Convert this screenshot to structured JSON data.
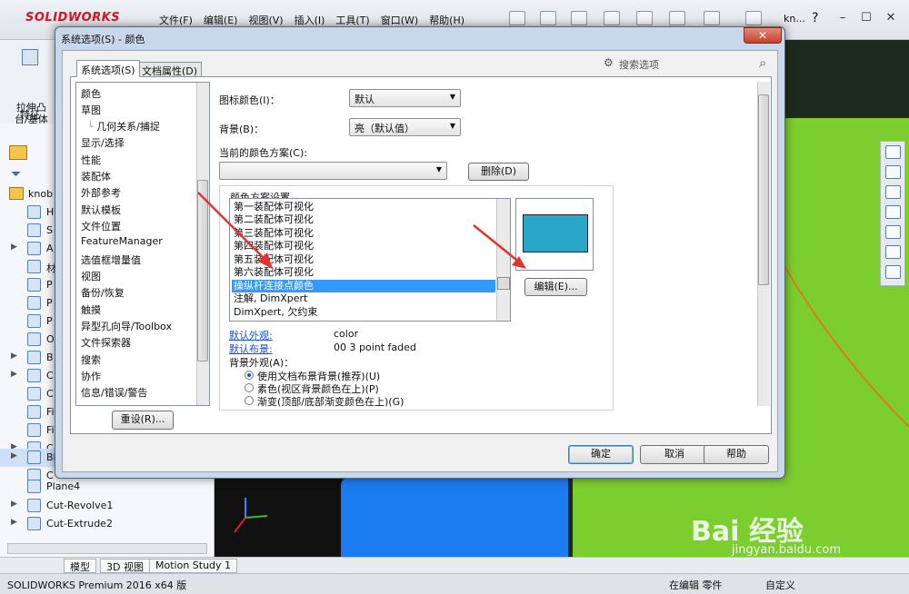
{
  "app": {
    "logo": "SOLIDWORKS",
    "menus": [
      "文件(F)",
      "编辑(E)",
      "视图(V)",
      "插入(I)",
      "工具(T)",
      "窗口(W)",
      "帮助(H)"
    ],
    "user": "kn...",
    "help": "?"
  },
  "command_manager": {
    "extrude_label": "拉伸凸\n台/基体",
    "feature_tab": "特征"
  },
  "tree": {
    "root": "knob",
    "rows": [
      {
        "label": "H"
      },
      {
        "label": "S"
      },
      {
        "label": "A"
      },
      {
        "label": "材"
      },
      {
        "label": "P"
      },
      {
        "label": "P"
      },
      {
        "label": "P"
      },
      {
        "label": "O"
      },
      {
        "label": "B"
      },
      {
        "label": "C"
      },
      {
        "label": "C"
      },
      {
        "label": "Fi"
      },
      {
        "label": "Fi"
      },
      {
        "label": "C"
      },
      {
        "label": "Bi"
      },
      {
        "label": "C"
      },
      {
        "label": "Plane4"
      },
      {
        "label": "Cut-Revolve1"
      },
      {
        "label": "Cut-Extrude2"
      }
    ]
  },
  "bottom_tabs": [
    "模型",
    "3D 视图",
    "Motion Study 1"
  ],
  "status": {
    "left": "SOLIDWORKS Premium 2016 x64 版",
    "editing": "在编辑 零件",
    "custom": "自定义"
  },
  "dialog": {
    "title": "系统选项(S) - 颜色",
    "close": "✕",
    "tab_system": "系统选项(S)",
    "tab_document": "文档属性(D)",
    "search_placeholder": "搜索选项",
    "categories": [
      "颜色",
      "草图",
      "几何关系/捕捉",
      "显示/选择",
      "性能",
      "装配体",
      "外部参考",
      "默认模板",
      "文件位置",
      "FeatureManager",
      "选值框增量值",
      "视图",
      "备份/恢复",
      "触摸",
      "异型孔向导/Toolbox",
      "文件探索器",
      "搜索",
      "协作",
      "信息/错误/警告"
    ],
    "reset_button": "重设(R)...",
    "icon_color_label": "图标颜色(I)：",
    "icon_color_value": "默认",
    "background_label": "背景(B)：",
    "background_value": "亮（默认值）",
    "current_scheme_label": "当前的颜色方案(C):",
    "current_scheme_value": "",
    "delete_button": "删除(D)",
    "scheme_group_label": "颜色方案设置",
    "scheme_items": [
      "第一装配体可视化",
      "第二装配体可视化",
      "第三装配体可视化",
      "第四装配体可视化",
      "第五装配体可视化",
      "第六装配体可视化",
      "操纵杆连接点颜色",
      "注解, DimXpert",
      "DimXpert, 欠约束"
    ],
    "selected_index": 6,
    "swatch_color": "#2aa6c9",
    "edit_button": "编辑(E)...",
    "default_appearance_label": "默认外观:",
    "default_appearance_value": "color",
    "default_scene_label": "默认布景:",
    "default_scene_value": "00 3 point faded",
    "bg_appearance_label": "背景外观(A)：",
    "bg_options": [
      {
        "label": "使用文档布景背景(推荐)(U)",
        "checked": true
      },
      {
        "label": "素色(视区背景颜色在上)(P)",
        "checked": false
      },
      {
        "label": "渐变(顶部/底部渐变颜色在上)(G)",
        "checked": false
      }
    ],
    "ok": "确定",
    "cancel": "取消",
    "help": "帮助"
  },
  "watermark": {
    "brand": "Bai 经验",
    "url": "jingyan.baidu.com"
  }
}
